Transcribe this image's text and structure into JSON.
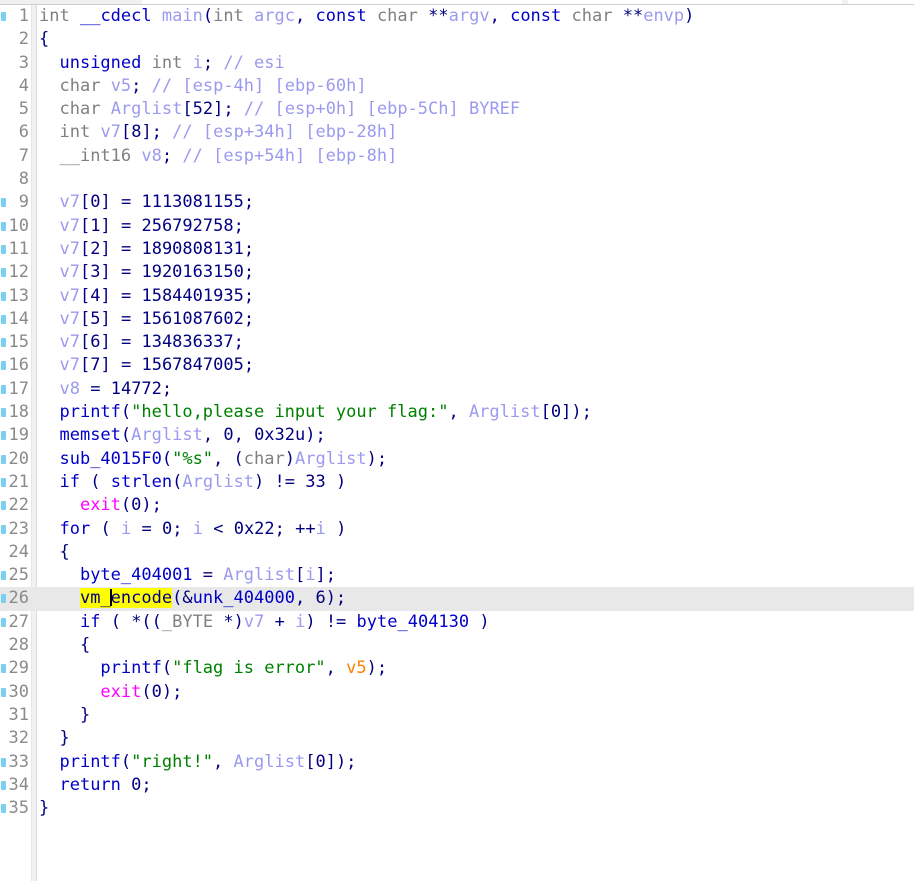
{
  "window": {
    "view": "Pseudocode-A",
    "app": "IDA Pro decompiler"
  },
  "gutter": {
    "dot_icon": "address-marker-dot"
  },
  "highlight": {
    "token": "vm_encode",
    "token_prefix": "vm_",
    "token_suffix": "encode",
    "line": 26,
    "color": "#ffff00",
    "row_color": "#e8e8e8"
  },
  "colors": {
    "background": "#ffffff",
    "gutter": "#f2f2f2",
    "lineno": "#8a8a8a",
    "keyword": "#0000c8",
    "type": "#808080",
    "variable": "#9a9aef",
    "string": "#008000",
    "comment": "#9a9aef",
    "libfunc": "#ff00ff",
    "orange": "#ff8000",
    "addr_dot": "#7ad0f0"
  },
  "code": {
    "lines": [
      {
        "n": "1",
        "dot": true,
        "text": "int __cdecl main(int argc, const char **argv, const char **envp)"
      },
      {
        "n": "2",
        "dot": false,
        "text": "{"
      },
      {
        "n": "3",
        "dot": false,
        "text": "  unsigned int i; // esi"
      },
      {
        "n": "4",
        "dot": false,
        "text": "  char v5; // [esp-4h] [ebp-60h]"
      },
      {
        "n": "5",
        "dot": false,
        "text": "  char Arglist[52]; // [esp+0h] [ebp-5Ch] BYREF"
      },
      {
        "n": "6",
        "dot": false,
        "text": "  int v7[8]; // [esp+34h] [ebp-28h]"
      },
      {
        "n": "7",
        "dot": false,
        "text": "  __int16 v8; // [esp+54h] [ebp-8h]"
      },
      {
        "n": "8",
        "dot": false,
        "text": ""
      },
      {
        "n": "9",
        "dot": true,
        "text": "  v7[0] = 1113081155;"
      },
      {
        "n": "10",
        "dot": true,
        "text": "  v7[1] = 256792758;"
      },
      {
        "n": "11",
        "dot": true,
        "text": "  v7[2] = 1890808131;"
      },
      {
        "n": "12",
        "dot": true,
        "text": "  v7[3] = 1920163150;"
      },
      {
        "n": "13",
        "dot": true,
        "text": "  v7[4] = 1584401935;"
      },
      {
        "n": "14",
        "dot": true,
        "text": "  v7[5] = 1561087602;"
      },
      {
        "n": "15",
        "dot": true,
        "text": "  v7[6] = 134836337;"
      },
      {
        "n": "16",
        "dot": true,
        "text": "  v7[7] = 1567847005;"
      },
      {
        "n": "17",
        "dot": true,
        "text": "  v8 = 14772;"
      },
      {
        "n": "18",
        "dot": true,
        "text": "  printf(\"hello,please input your flag:\", Arglist[0]);"
      },
      {
        "n": "19",
        "dot": true,
        "text": "  memset(Arglist, 0, 0x32u);"
      },
      {
        "n": "20",
        "dot": true,
        "text": "  sub_4015F0(\"%s\", (char)Arglist);"
      },
      {
        "n": "21",
        "dot": true,
        "text": "  if ( strlen(Arglist) != 33 )"
      },
      {
        "n": "22",
        "dot": true,
        "text": "    exit(0);"
      },
      {
        "n": "23",
        "dot": true,
        "text": "  for ( i = 0; i < 0x22; ++i )"
      },
      {
        "n": "24",
        "dot": false,
        "text": "  {"
      },
      {
        "n": "25",
        "dot": true,
        "text": "    byte_404001 = Arglist[i];"
      },
      {
        "n": "26",
        "dot": true,
        "text": "    vm_encode(&unk_404000, 6);"
      },
      {
        "n": "27",
        "dot": true,
        "text": "    if ( *((_BYTE *)v7 + i) != byte_404130 )"
      },
      {
        "n": "28",
        "dot": false,
        "text": "    {"
      },
      {
        "n": "29",
        "dot": true,
        "text": "      printf(\"flag is error\", v5);"
      },
      {
        "n": "30",
        "dot": true,
        "text": "      exit(0);"
      },
      {
        "n": "31",
        "dot": false,
        "text": "    }"
      },
      {
        "n": "32",
        "dot": false,
        "text": "  }"
      },
      {
        "n": "33",
        "dot": true,
        "text": "  printf(\"right!\", Arglist[0]);"
      },
      {
        "n": "34",
        "dot": true,
        "text": "  return 0;"
      },
      {
        "n": "35",
        "dot": true,
        "text": "}"
      }
    ],
    "tokens": {
      "line1": [
        [
          "kw",
          "int "
        ],
        [
          "kw",
          "__cdecl "
        ],
        [
          "fn",
          "main"
        ],
        [
          "kw",
          "("
        ],
        [
          "type",
          "int"
        ],
        [
          "kw",
          " argc, "
        ],
        [
          "kw",
          "const "
        ],
        [
          "type",
          "char"
        ],
        [
          "kw",
          " **argv, "
        ],
        [
          "kw",
          "const "
        ],
        [
          "type",
          "char"
        ],
        [
          "kw",
          " **envp)"
        ]
      ],
      "line3": [
        [
          "kw",
          "  unsigned int"
        ],
        [
          "var",
          " i"
        ],
        [
          "kw",
          ";"
        ],
        [
          "cmt",
          " // esi"
        ]
      ],
      "line4": [
        [
          "kw",
          "  char"
        ],
        [
          "var",
          " v5"
        ],
        [
          "kw",
          ";"
        ],
        [
          "cmt",
          " // [esp-4h] [ebp-60h]"
        ]
      ],
      "line5": [
        [
          "kw",
          "  char"
        ],
        [
          "var",
          " Arglist"
        ],
        [
          "kw",
          "[52];"
        ],
        [
          "cmt",
          " // [esp+0h] [ebp-5Ch] BYREF"
        ]
      ],
      "line6": [
        [
          "kw",
          "  int"
        ],
        [
          "var",
          " v7"
        ],
        [
          "kw",
          "[8];"
        ],
        [
          "cmt",
          " // [esp+34h] [ebp-28h]"
        ]
      ],
      "line7": [
        [
          "kw",
          "  __int16"
        ],
        [
          "var",
          " v8"
        ],
        [
          "kw",
          ";"
        ],
        [
          "cmt",
          " // [esp+54h] [ebp-8h]"
        ]
      ],
      "assign": [
        [
          "var",
          "v7"
        ],
        [
          "kw",
          "[0] = "
        ],
        [
          "num",
          "1113081155"
        ],
        [
          "kw",
          ";"
        ]
      ],
      "line18": [
        [
          "fn",
          "  printf"
        ],
        [
          "kw",
          "("
        ],
        [
          "str",
          "\"hello,please input your flag:\""
        ],
        [
          "kw",
          ", "
        ],
        [
          "var",
          "Arglist"
        ],
        [
          "kw",
          "[0]);"
        ]
      ],
      "line19": [
        [
          "fn",
          "  memset"
        ],
        [
          "kw",
          "("
        ],
        [
          "var",
          "Arglist"
        ],
        [
          "kw",
          ", 0, 0x32u);"
        ]
      ],
      "line20": [
        [
          "fn",
          "  sub_4015F0"
        ],
        [
          "kw",
          "("
        ],
        [
          "str",
          "\"%s\""
        ],
        [
          "kw",
          ", ("
        ],
        [
          "type",
          "char"
        ],
        [
          "kw",
          ")"
        ],
        [
          "var",
          "Arglist"
        ],
        [
          "kw",
          ");"
        ]
      ],
      "line21": [
        [
          "kw",
          "  if ( "
        ],
        [
          "fn",
          "strlen"
        ],
        [
          "kw",
          "("
        ],
        [
          "var",
          "Arglist"
        ],
        [
          "kw",
          ") != 33 )"
        ]
      ],
      "line22": [
        [
          "libfn",
          "    exit"
        ],
        [
          "kw",
          "(0);"
        ]
      ],
      "line23": [
        [
          "kw",
          "  for ( "
        ],
        [
          "var",
          "i"
        ],
        [
          "kw",
          " = 0; "
        ],
        [
          "var",
          "i"
        ],
        [
          "kw",
          " < 0x22; ++"
        ],
        [
          "var",
          "i"
        ],
        [
          "kw",
          " )"
        ]
      ],
      "line25": [
        [
          "fn",
          "    byte_404001"
        ],
        [
          "kw",
          " = "
        ],
        [
          "var",
          "Arglist"
        ],
        [
          "kw",
          "["
        ],
        [
          "var",
          "i"
        ],
        [
          "kw",
          "];"
        ]
      ],
      "line26": [
        [
          "hl",
          "vm_encode"
        ],
        [
          "kw",
          "(&"
        ],
        [
          "fn",
          "unk_404000"
        ],
        [
          "kw",
          ", 6);"
        ]
      ],
      "line27": [
        [
          "kw",
          "    if ( *(("
        ],
        [
          "type",
          "_BYTE"
        ],
        [
          "kw",
          " *)"
        ],
        [
          "var",
          "v7"
        ],
        [
          "kw",
          " + "
        ],
        [
          "var",
          "i"
        ],
        [
          "kw",
          ") != "
        ],
        [
          "fn",
          "byte_404130"
        ],
        [
          "kw",
          " )"
        ]
      ],
      "line29": [
        [
          "fn",
          "      printf"
        ],
        [
          "kw",
          "("
        ],
        [
          "str",
          "\"flag is error\""
        ],
        [
          "kw",
          ", "
        ],
        [
          "orange",
          "v5"
        ],
        [
          "kw",
          ");"
        ]
      ],
      "line33": [
        [
          "fn",
          "  printf"
        ],
        [
          "kw",
          "("
        ],
        [
          "str",
          "\"right!\""
        ],
        [
          "kw",
          ", "
        ],
        [
          "var",
          "Arglist"
        ],
        [
          "kw",
          "[0]);"
        ]
      ],
      "line34": [
        [
          "kw",
          "  return 0;"
        ]
      ]
    }
  }
}
